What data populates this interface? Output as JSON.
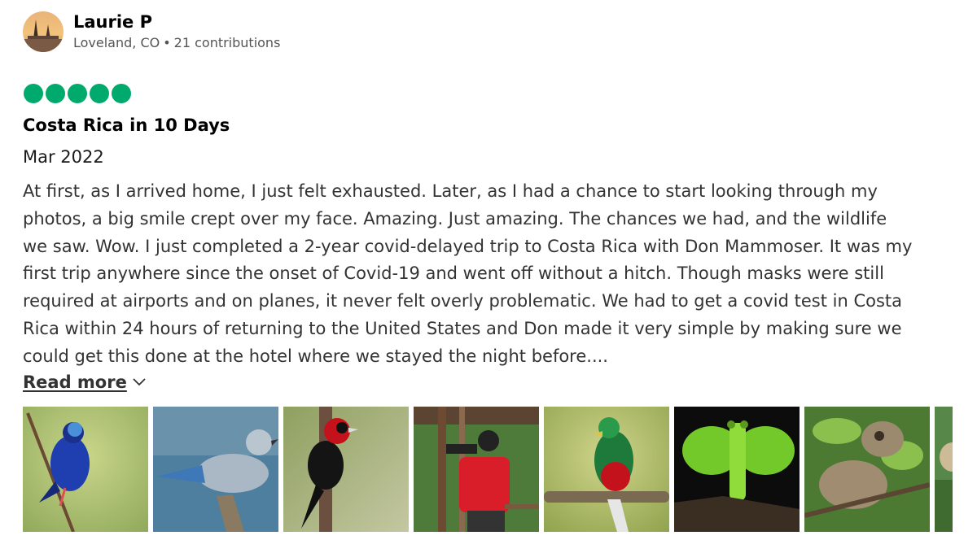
{
  "reviewer": {
    "name": "Laurie P",
    "location": "Loveland, CO",
    "separator": "•",
    "contributions": "21 contributions"
  },
  "rating": {
    "value": 5,
    "max": 5,
    "color": "#00aa6c"
  },
  "review": {
    "title": "Costa Rica in 10 Days",
    "date": "Mar 2022",
    "body_lines": [
      "At first, as I arrived home, I just felt exhausted. Later, as I had a chance to start looking through my",
      "photos, a big smile crept over my face. Amazing. Just amazing. The chances we had, and the wildlife",
      "we saw. Wow. I just completed a 2-year covid-delayed trip to Costa Rica with Don Mammoser. It was my",
      "first trip anywhere since the onset of Covid-19 and went off without a hitch. Though masks were still",
      "required at airports and on planes, it never felt overly problematic. We had to get a covid test in Costa",
      "Rica within 24 hours of returning to the United States and Don made it very simple by making sure we",
      "could get this done at the hotel where we stayed the night before...."
    ],
    "read_more": "Read more"
  },
  "photos": [
    {
      "subject": "blue bird on branch"
    },
    {
      "subject": "blue-gray tanager"
    },
    {
      "subject": "crimson-collared tanager"
    },
    {
      "subject": "photographer on deck"
    },
    {
      "subject": "resplendent quetzal"
    },
    {
      "subject": "green leaf mantis"
    },
    {
      "subject": "sloth in tree"
    },
    {
      "subject": "partial photo"
    }
  ],
  "icons": {
    "avatar": "sunset-avatar",
    "read_more": "chevron-down-icon"
  }
}
